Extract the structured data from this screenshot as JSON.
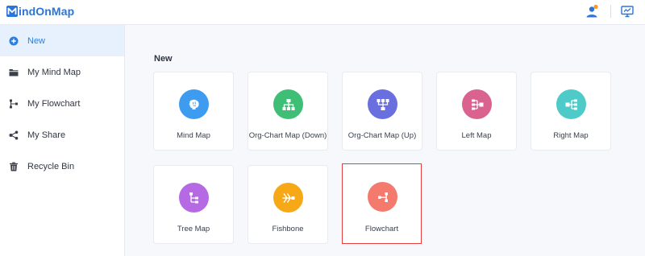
{
  "app": {
    "logo_text": "indOnMap",
    "logo_initial": "M"
  },
  "colors": {
    "accent": "#2b7fe0",
    "sidebar_active_bg": "#e6f1fd",
    "selected_border": "#e53e3e"
  },
  "sidebar": {
    "items": [
      {
        "label": "New",
        "icon": "plus-circle-icon",
        "active": true
      },
      {
        "label": "My Mind Map",
        "icon": "folder-icon"
      },
      {
        "label": "My Flowchart",
        "icon": "flowchart-icon"
      },
      {
        "label": "My Share",
        "icon": "share-icon"
      },
      {
        "label": "Recycle Bin",
        "icon": "trash-icon"
      }
    ]
  },
  "main": {
    "section_title": "New",
    "cards": [
      {
        "label": "Mind Map",
        "icon": "brain-icon",
        "color": "#3d9bf0"
      },
      {
        "label": "Org-Chart Map (Down)",
        "icon": "org-chart-down-icon",
        "color": "#3fbf76"
      },
      {
        "label": "Org-Chart Map (Up)",
        "icon": "org-chart-up-icon",
        "color": "#6a6fe0"
      },
      {
        "label": "Left Map",
        "icon": "left-map-icon",
        "color": "#d9628f"
      },
      {
        "label": "Right Map",
        "icon": "right-map-icon",
        "color": "#4ecbc9"
      },
      {
        "label": "Tree Map",
        "icon": "tree-map-icon",
        "color": "#b56ae3"
      },
      {
        "label": "Fishbone",
        "icon": "fishbone-icon",
        "color": "#f6a817"
      },
      {
        "label": "Flowchart",
        "icon": "flowchart-icon",
        "color": "#f47a6e",
        "selected": true
      }
    ]
  }
}
